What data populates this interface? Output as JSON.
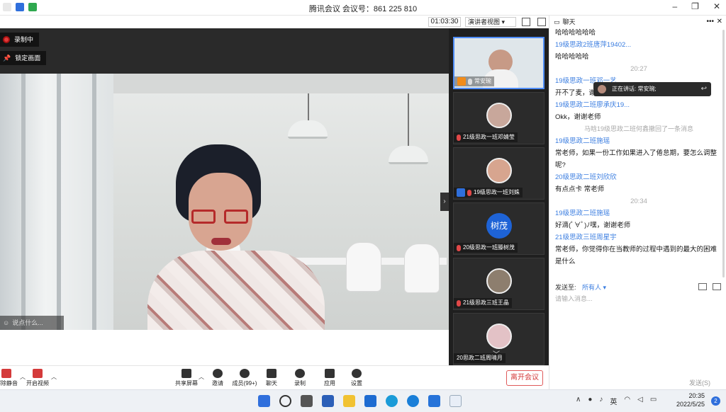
{
  "window": {
    "title": "腾讯会议 会议号：861 225 810"
  },
  "video_bar": {
    "timer": "01:03:30",
    "view_mode": "演讲者视图"
  },
  "video": {
    "recording_label": "录制中",
    "pin_label": "锁定画面",
    "say_placeholder": "说点什么..."
  },
  "participants": [
    {
      "name": "常安琬",
      "muted": false,
      "host": true
    },
    {
      "name": "21级思政一班邓婧莹",
      "muted": true,
      "host": false
    },
    {
      "name": "19级思政一班刘姝",
      "muted": true,
      "host": true
    },
    {
      "name": "20级思政一班滕树茂",
      "muted": true,
      "avatar_text": "树茂",
      "host": false
    },
    {
      "name": "21级思政三班王晶",
      "muted": true,
      "host": false
    },
    {
      "name": "20思政二班周晴月",
      "muted": false,
      "host": false
    }
  ],
  "toolbar": {
    "unmute": "解除静音",
    "start_video": "开启视频",
    "share_screen": "共享屏幕",
    "invite": "邀请",
    "members": "成员(99+)",
    "chat": "聊天",
    "record": "录制",
    "apps": "应用",
    "settings": "设置",
    "leave": "离开会议"
  },
  "chat": {
    "title": "聊天",
    "speaking": "正在讲话: 常安琬;",
    "messages": [
      {
        "kind": "text",
        "text": "哈哈哈哈哈哈"
      },
      {
        "kind": "name",
        "text": "19级思政2班唐萍19402..."
      },
      {
        "kind": "text",
        "text": "哈哈哈哈哈"
      },
      {
        "kind": "time",
        "text": "20:27"
      },
      {
        "kind": "name",
        "text": "19级思政一班邓一艺"
      },
      {
        "kind": "text",
        "text": "开不了麦，谢谢老师"
      },
      {
        "kind": "name",
        "text": "19级思政二班廖承庆19..."
      },
      {
        "kind": "text",
        "text": "Okk，谢谢老师"
      },
      {
        "kind": "sys",
        "text": "马晗19级思政二班何鑫撤回了一条消息"
      },
      {
        "kind": "name",
        "text": "19级思政二班施瑶"
      },
      {
        "kind": "text",
        "text": "常老师，如果一份工作如果进入了倦怠期，要怎么调整呢?"
      },
      {
        "kind": "name",
        "text": "20级思政二班刘欣欣"
      },
      {
        "kind": "text",
        "text": "有点点卡 常老师"
      },
      {
        "kind": "time",
        "text": "20:34"
      },
      {
        "kind": "name",
        "text": "19级思政二班施瑶"
      },
      {
        "kind": "text",
        "text": "好滴(ﾟ∀ﾟ)ﾉ嘿，谢谢老师"
      },
      {
        "kind": "name",
        "text": "21级思政三班周星宇"
      },
      {
        "kind": "text",
        "text": "常老师，你觉得你在当教师的过程中遇到的最大的困难是什么"
      }
    ],
    "send_to_label": "发送至:",
    "send_to_value": "所有人",
    "input_placeholder": "请输入消息...",
    "send_button": "发送(S)"
  },
  "taskbar": {
    "ime": "英",
    "time": "20:35",
    "date": "2022/5/25",
    "notifications": "2"
  }
}
